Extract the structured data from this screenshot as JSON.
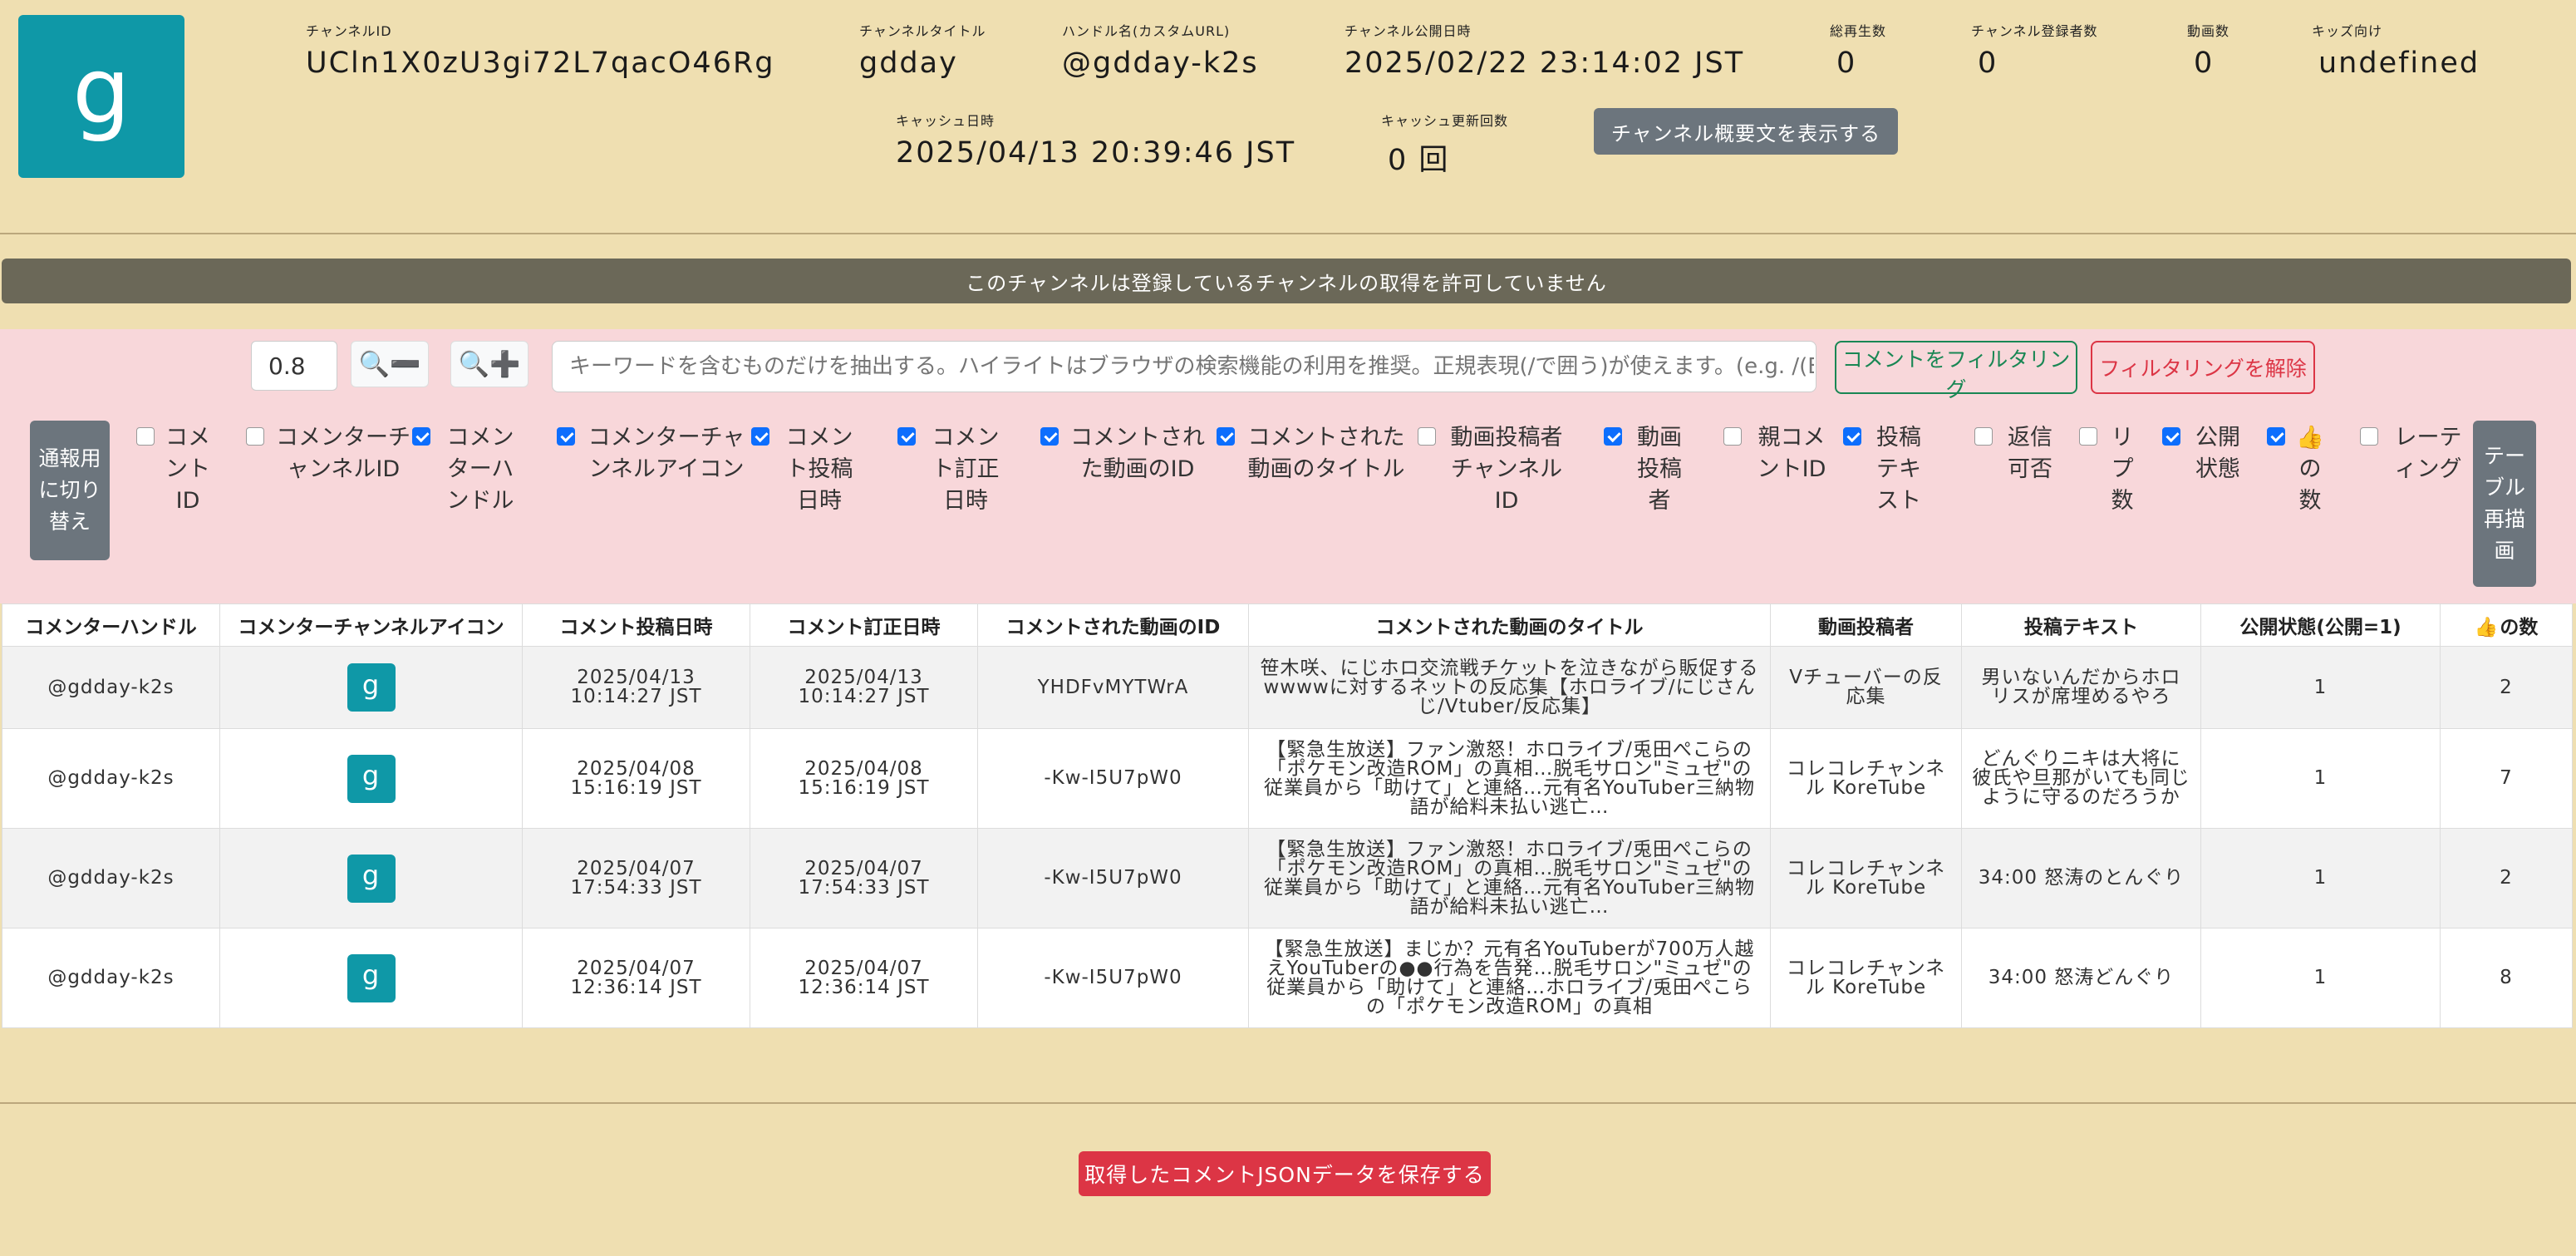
{
  "channel": {
    "avatar_letter": "g",
    "id_label": "チャンネルID",
    "id_value": "UCln1X0zU3gi72L7qacO46Rg",
    "title_label": "チャンネルタイトル",
    "title_value": "gdday",
    "handle_label": "ハンドル名(カスタムURL)",
    "handle_value": "@gdday-k2s",
    "published_label": "チャンネル公開日時",
    "published_value": "2025/02/22 23:14:02 JST",
    "views_label": "総再生数",
    "views_value": "0",
    "subs_label": "チャンネル登録者数",
    "subs_value": "0",
    "videos_label": "動画数",
    "videos_value": "0",
    "kids_label": "キッズ向け",
    "kids_value": "undefined",
    "cache_label": "キャッシュ日時",
    "cache_value": "2025/04/13 20:39:46 JST",
    "cache_count_label": "キャッシュ更新回数",
    "cache_count_value": "0 回",
    "desc_button": "チャンネル概要文を表示する"
  },
  "banner": "このチャンネルは登録しているチャンネルの取得を許可していません",
  "controls": {
    "zoom_value": "0.8",
    "zoom_minus": "🔍➖",
    "zoom_plus": "🔍➕",
    "search_placeholder": "キーワードを含むものだけを抽出する。ハイライトはブラウザの検索機能の利用を推奨。正規表現(/で囲う)が使えます。(e.g. /(BC|AD|",
    "filter_button": "コメントをフィルタリング",
    "unfilter_button": "フィルタリングを解除",
    "mode_button": "通報用に切り替え",
    "redraw_button": "テーブル再描画"
  },
  "columns": [
    {
      "label": "コメントID",
      "checked": false
    },
    {
      "label": "コメンターチャンネルID",
      "checked": false
    },
    {
      "label": "コメンターハンドル",
      "checked": true
    },
    {
      "label": "コメンターチャンネルアイコン",
      "checked": true
    },
    {
      "label": "コメント投稿日時",
      "checked": true
    },
    {
      "label": "コメント訂正日時",
      "checked": true
    },
    {
      "label": "コメントされた動画のID",
      "checked": true
    },
    {
      "label": "コメントされた動画のタイトル",
      "checked": true
    },
    {
      "label": "動画投稿者チャンネルID",
      "checked": false
    },
    {
      "label": "動画投稿者",
      "checked": true
    },
    {
      "label": "親コメントID",
      "checked": false
    },
    {
      "label": "投稿テキスト",
      "checked": true
    },
    {
      "label": "返信可否",
      "checked": false
    },
    {
      "label": "リプ数",
      "checked": false
    },
    {
      "label": "公開状態",
      "checked": true
    },
    {
      "label": "👍の数",
      "checked": true
    },
    {
      "label": "レーティング",
      "checked": false
    }
  ],
  "table": {
    "headers": [
      "コメンターハンドル",
      "コメンターチャンネルアイコン",
      "コメント投稿日時",
      "コメント訂正日時",
      "コメントされた動画のID",
      "コメントされた動画のタイトル",
      "動画投稿者",
      "投稿テキスト",
      "公開状態(公開=1)",
      "の数"
    ],
    "thumb_icon": "👍",
    "rows": [
      {
        "handle": "@gdday-k2s",
        "icon": "g",
        "posted": "2025/04/13 10:14:27 JST",
        "edited": "2025/04/13 10:14:27 JST",
        "video_id": "YHDFvMYTWrA",
        "video_title": "笹木咲、にじホロ交流戦チケットを泣きながら販促するwwwwに対するネットの反応集【ホロライブ/にじさんじ/Vtuber/反応集】",
        "uploader": "Vチューバーの反応集",
        "text": "男いないんだからホロリスが席埋めるやろ",
        "public": "1",
        "likes": "2"
      },
      {
        "handle": "@gdday-k2s",
        "icon": "g",
        "posted": "2025/04/08 15:16:19 JST",
        "edited": "2025/04/08 15:16:19 JST",
        "video_id": "-Kw-I5U7pW0",
        "video_title": "【緊急生放送】ファン激怒！ホロライブ/兎田ぺこらの「ポケモン改造ROM」の真相…脱毛サロン\"ミュゼ\"の従業員から「助けて」と連絡…元有名YouTuber三納物語が給料未払い逃亡…",
        "uploader": "コレコレチャンネル KoreTube",
        "text": "どんぐりニキは大将に彼氏や旦那がいても同じように守るのだろうか",
        "public": "1",
        "likes": "7"
      },
      {
        "handle": "@gdday-k2s",
        "icon": "g",
        "posted": "2025/04/07 17:54:33 JST",
        "edited": "2025/04/07 17:54:33 JST",
        "video_id": "-Kw-I5U7pW0",
        "video_title": "【緊急生放送】ファン激怒！ホロライブ/兎田ぺこらの「ポケモン改造ROM」の真相…脱毛サロン\"ミュゼ\"の従業員から「助けて」と連絡…元有名YouTuber三納物語が給料未払い逃亡…",
        "uploader": "コレコレチャンネル KoreTube",
        "text": "34:00 怒涛のとんぐり",
        "public": "1",
        "likes": "2"
      },
      {
        "handle": "@gdday-k2s",
        "icon": "g",
        "posted": "2025/04/07 12:36:14 JST",
        "edited": "2025/04/07 12:36:14 JST",
        "video_id": "-Kw-I5U7pW0",
        "video_title": "【緊急生放送】まじか？元有名YouTuberが700万人越えYouTuberの●●行為を告発…脱毛サロン\"ミュゼ\"の従業員から「助けて」と連絡…ホロライブ/兎田ぺこらの「ポケモン改造ROM」の真相",
        "uploader": "コレコレチャンネル KoreTube",
        "text": "34:00 怒涛どんぐり",
        "public": "1",
        "likes": "8"
      }
    ]
  },
  "footer": {
    "save_button": "取得したコメントJSONデータを保存する"
  },
  "colors": {
    "background": "#efdfb1",
    "accent": "#0f98a7",
    "pink": "#f8d7da",
    "banner": "#6b6858"
  }
}
